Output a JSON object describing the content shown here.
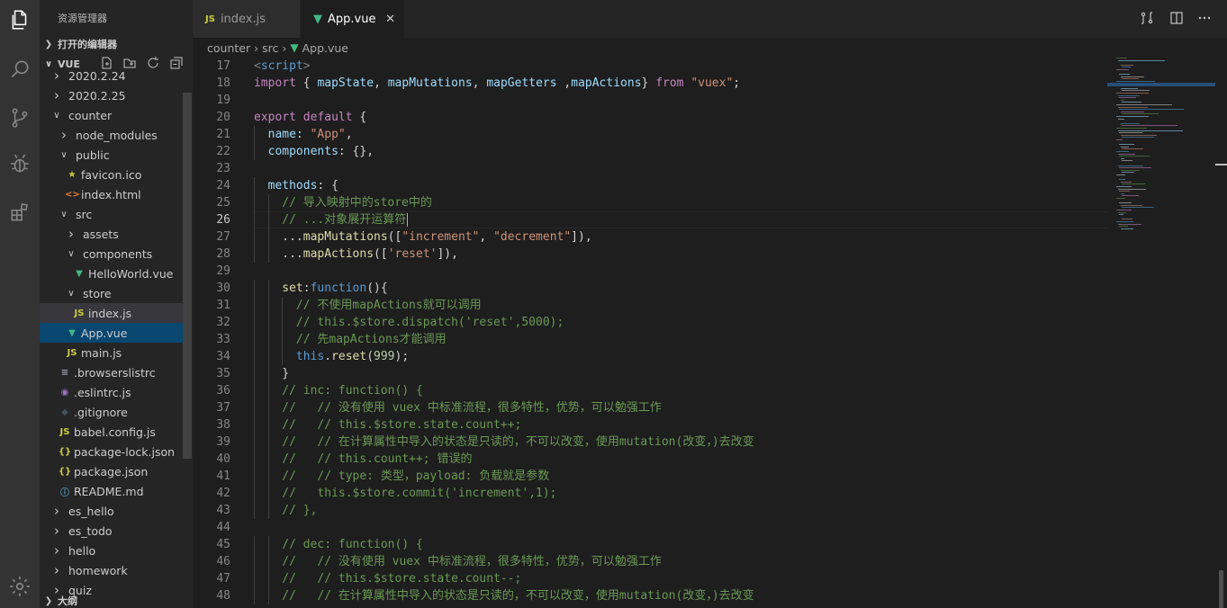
{
  "sidebar": {
    "title": "资源管理器",
    "open_editors": "打开的编辑器",
    "folder": "VUE",
    "outline": "大纲",
    "tree": [
      {
        "label": "2020.2.24",
        "depth": 0,
        "open": false,
        "icon": ""
      },
      {
        "label": "2020.2.25",
        "depth": 0,
        "open": false,
        "icon": ""
      },
      {
        "label": "counter",
        "depth": 0,
        "open": true,
        "icon": ""
      },
      {
        "label": "node_modules",
        "depth": 1,
        "open": false,
        "icon": ""
      },
      {
        "label": "public",
        "depth": 1,
        "open": true,
        "icon": ""
      },
      {
        "label": "favicon.ico",
        "depth": 2,
        "icon": "star-icon"
      },
      {
        "label": "index.html",
        "depth": 2,
        "icon": "html-icon"
      },
      {
        "label": "src",
        "depth": 1,
        "open": true,
        "icon": ""
      },
      {
        "label": "assets",
        "depth": 2,
        "open": false,
        "icon": ""
      },
      {
        "label": "components",
        "depth": 2,
        "open": true,
        "icon": ""
      },
      {
        "label": "HelloWorld.vue",
        "depth": 3,
        "icon": "vue-icon"
      },
      {
        "label": "store",
        "depth": 2,
        "open": true,
        "icon": ""
      },
      {
        "label": "index.js",
        "depth": 3,
        "icon": "js-icon",
        "state": "selected"
      },
      {
        "label": "App.vue",
        "depth": 2,
        "icon": "vue-icon",
        "state": "active"
      },
      {
        "label": "main.js",
        "depth": 2,
        "icon": "js-icon"
      },
      {
        "label": ".browserslistrc",
        "depth": 1,
        "icon": "lines-icon"
      },
      {
        "label": ".eslintrc.js",
        "depth": 1,
        "icon": "eslint-icon"
      },
      {
        "label": ".gitignore",
        "depth": 1,
        "icon": "git-icon"
      },
      {
        "label": "babel.config.js",
        "depth": 1,
        "icon": "js-icon"
      },
      {
        "label": "package-lock.json",
        "depth": 1,
        "icon": "json-icon"
      },
      {
        "label": "package.json",
        "depth": 1,
        "icon": "json-icon"
      },
      {
        "label": "README.md",
        "depth": 1,
        "icon": "info-icon"
      },
      {
        "label": "es_hello",
        "depth": 0,
        "open": false,
        "icon": ""
      },
      {
        "label": "es_todo",
        "depth": 0,
        "open": false,
        "icon": ""
      },
      {
        "label": "hello",
        "depth": 0,
        "open": false,
        "icon": ""
      },
      {
        "label": "homework",
        "depth": 0,
        "open": false,
        "icon": ""
      },
      {
        "label": "quiz",
        "depth": 0,
        "open": false,
        "icon": ""
      }
    ]
  },
  "tabs": [
    {
      "label": "index.js",
      "icon": "js-icon",
      "active": false
    },
    {
      "label": "App.vue",
      "icon": "vue-icon",
      "active": true
    }
  ],
  "breadcrumb": [
    "counter",
    "src",
    "App.vue"
  ],
  "colors": {
    "vue": "#41b883",
    "js": "#cbcb41",
    "html": "#e37933",
    "activity_bg": "#333333",
    "sidebar_bg": "#252526",
    "editor_bg": "#1e1e1e"
  },
  "editor": {
    "cursor_line": 26,
    "lines": [
      {
        "n": 17,
        "indent": 0,
        "t": [
          [
            "tag",
            "<"
          ],
          [
            "tn",
            "script"
          ],
          [
            "tag",
            ">"
          ]
        ]
      },
      {
        "n": 18,
        "indent": 0,
        "t": [
          [
            "ctl",
            "import"
          ],
          [
            "t",
            " { "
          ],
          [
            "pr",
            "mapState"
          ],
          [
            "t",
            ", "
          ],
          [
            "pr",
            "mapMutations"
          ],
          [
            "t",
            ", "
          ],
          [
            "pr",
            "mapGetters"
          ],
          [
            "t",
            " ,"
          ],
          [
            "pr",
            "mapActions"
          ],
          [
            "t",
            "} "
          ],
          [
            "ctl",
            "from"
          ],
          [
            "t",
            " "
          ],
          [
            "str",
            "\"vuex\""
          ],
          [
            "t",
            ";"
          ]
        ]
      },
      {
        "n": 19,
        "indent": 0,
        "t": []
      },
      {
        "n": 20,
        "indent": 0,
        "t": [
          [
            "ctl",
            "export"
          ],
          [
            "t",
            " "
          ],
          [
            "ctl",
            "default"
          ],
          [
            "t",
            " {"
          ]
        ]
      },
      {
        "n": 21,
        "indent": 1,
        "t": [
          [
            "pr",
            "name"
          ],
          [
            "t",
            ": "
          ],
          [
            "str",
            "\"App\""
          ],
          [
            "t",
            ","
          ]
        ]
      },
      {
        "n": 22,
        "indent": 1,
        "t": [
          [
            "pr",
            "components"
          ],
          [
            "t",
            ": {},"
          ]
        ]
      },
      {
        "n": 23,
        "indent": 0,
        "t": []
      },
      {
        "n": 24,
        "indent": 1,
        "t": [
          [
            "pr",
            "methods"
          ],
          [
            "t",
            ": {"
          ]
        ]
      },
      {
        "n": 25,
        "indent": 2,
        "t": [
          [
            "cm",
            "// 导入映射中的store中的"
          ]
        ]
      },
      {
        "n": 26,
        "indent": 2,
        "t": [
          [
            "cm",
            "// ...对象展开运算符"
          ]
        ]
      },
      {
        "n": 27,
        "indent": 2,
        "t": [
          [
            "t",
            "..."
          ],
          [
            "fn",
            "mapMutations"
          ],
          [
            "t",
            "(["
          ],
          [
            "str",
            "\"increment\""
          ],
          [
            "t",
            ", "
          ],
          [
            "str",
            "\"decrement\""
          ],
          [
            "t",
            "]),"
          ]
        ]
      },
      {
        "n": 28,
        "indent": 2,
        "t": [
          [
            "t",
            "..."
          ],
          [
            "fn",
            "mapActions"
          ],
          [
            "t",
            "(["
          ],
          [
            "str",
            "'reset'"
          ],
          [
            "t",
            "]),"
          ]
        ]
      },
      {
        "n": 29,
        "indent": 0,
        "t": []
      },
      {
        "n": 30,
        "indent": 2,
        "t": [
          [
            "fn",
            "set"
          ],
          [
            "t",
            ":"
          ],
          [
            "kw",
            "function"
          ],
          [
            "t",
            "(){"
          ]
        ]
      },
      {
        "n": 31,
        "indent": 3,
        "t": [
          [
            "cm",
            "// 不使用mapActions就可以调用"
          ]
        ]
      },
      {
        "n": 32,
        "indent": 3,
        "t": [
          [
            "cm",
            "// this.$store.dispatch('reset',5000);"
          ]
        ]
      },
      {
        "n": 33,
        "indent": 3,
        "t": [
          [
            "cm",
            "// 先mapActions才能调用"
          ]
        ]
      },
      {
        "n": 34,
        "indent": 3,
        "t": [
          [
            "kw",
            "this"
          ],
          [
            "t",
            "."
          ],
          [
            "fn",
            "reset"
          ],
          [
            "t",
            "("
          ],
          [
            "n",
            "999"
          ],
          [
            "t",
            ");"
          ]
        ]
      },
      {
        "n": 35,
        "indent": 2,
        "t": [
          [
            "t",
            "}"
          ]
        ]
      },
      {
        "n": 36,
        "indent": 2,
        "t": [
          [
            "cm",
            "// inc: function() {"
          ]
        ]
      },
      {
        "n": 37,
        "indent": 2,
        "t": [
          [
            "cm",
            "//   // 没有使用 vuex 中标准流程，很多特性，优势，可以勉强工作"
          ]
        ]
      },
      {
        "n": 38,
        "indent": 2,
        "t": [
          [
            "cm",
            "//   // this.$store.state.count++;"
          ]
        ]
      },
      {
        "n": 39,
        "indent": 2,
        "t": [
          [
            "cm",
            "//   // 在计算属性中导入的状态是只读的，不可以改变，使用mutation(改变，)去改变"
          ]
        ]
      },
      {
        "n": 40,
        "indent": 2,
        "t": [
          [
            "cm",
            "//   // this.count++; 错误的"
          ]
        ]
      },
      {
        "n": 41,
        "indent": 2,
        "t": [
          [
            "cm",
            "//   // type: 类型，payload: 负载就是参数"
          ]
        ]
      },
      {
        "n": 42,
        "indent": 2,
        "t": [
          [
            "cm",
            "//   this.$store.commit('increment',1);"
          ]
        ]
      },
      {
        "n": 43,
        "indent": 2,
        "t": [
          [
            "cm",
            "// },"
          ]
        ]
      },
      {
        "n": 44,
        "indent": 0,
        "t": []
      },
      {
        "n": 45,
        "indent": 2,
        "t": [
          [
            "cm",
            "// dec: function() {"
          ]
        ]
      },
      {
        "n": 46,
        "indent": 2,
        "t": [
          [
            "cm",
            "//   // 没有使用 vuex 中标准流程，很多特性，优势，可以勉强工作"
          ]
        ]
      },
      {
        "n": 47,
        "indent": 2,
        "t": [
          [
            "cm",
            "//   // this.$store.state.count--;"
          ]
        ]
      },
      {
        "n": 48,
        "indent": 2,
        "t": [
          [
            "cm",
            "//   // 在计算属性中导入的状态是只读的，不可以改变，使用mutation(改变，)去改变"
          ]
        ]
      }
    ]
  }
}
